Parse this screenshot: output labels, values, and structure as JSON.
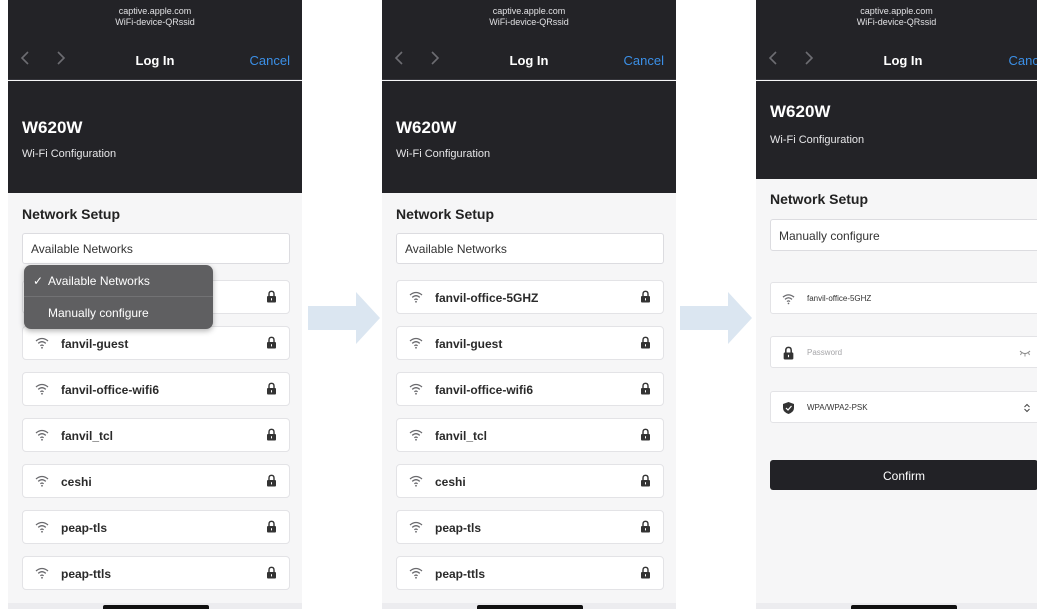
{
  "browser": {
    "host": "captive.apple.com",
    "ssid": "WiFi-device-QRssid",
    "title": "Log In",
    "cancel_label": "Cancel"
  },
  "page": {
    "model": "W620W",
    "subtitle": "Wi-Fi Configuration",
    "section_title": "Network Setup"
  },
  "panel1": {
    "select_value": "Available Networks",
    "menu": [
      {
        "label": "Available Networks",
        "checked": true
      },
      {
        "label": "Manually configure",
        "checked": false
      }
    ]
  },
  "panel2": {
    "select_value": "Available Networks"
  },
  "networks": [
    {
      "ssid": "fanvil-office-5GHZ"
    },
    {
      "ssid": "fanvil-guest"
    },
    {
      "ssid": "fanvil-office-wifi6"
    },
    {
      "ssid": "fanvil_tcl"
    },
    {
      "ssid": "ceshi"
    },
    {
      "ssid": "peap-tls"
    },
    {
      "ssid": "peap-ttls"
    }
  ],
  "panel3": {
    "select_value": "Manually configure",
    "ssid_value": "fanvil-office-5GHZ",
    "password_placeholder": "Password",
    "security_value": "WPA/WPA2-PSK",
    "confirm_label": "Confirm"
  },
  "colors": {
    "dark_bg": "#232327",
    "accent_link": "#3b8fe6",
    "arrow": "#dbe6f1"
  }
}
